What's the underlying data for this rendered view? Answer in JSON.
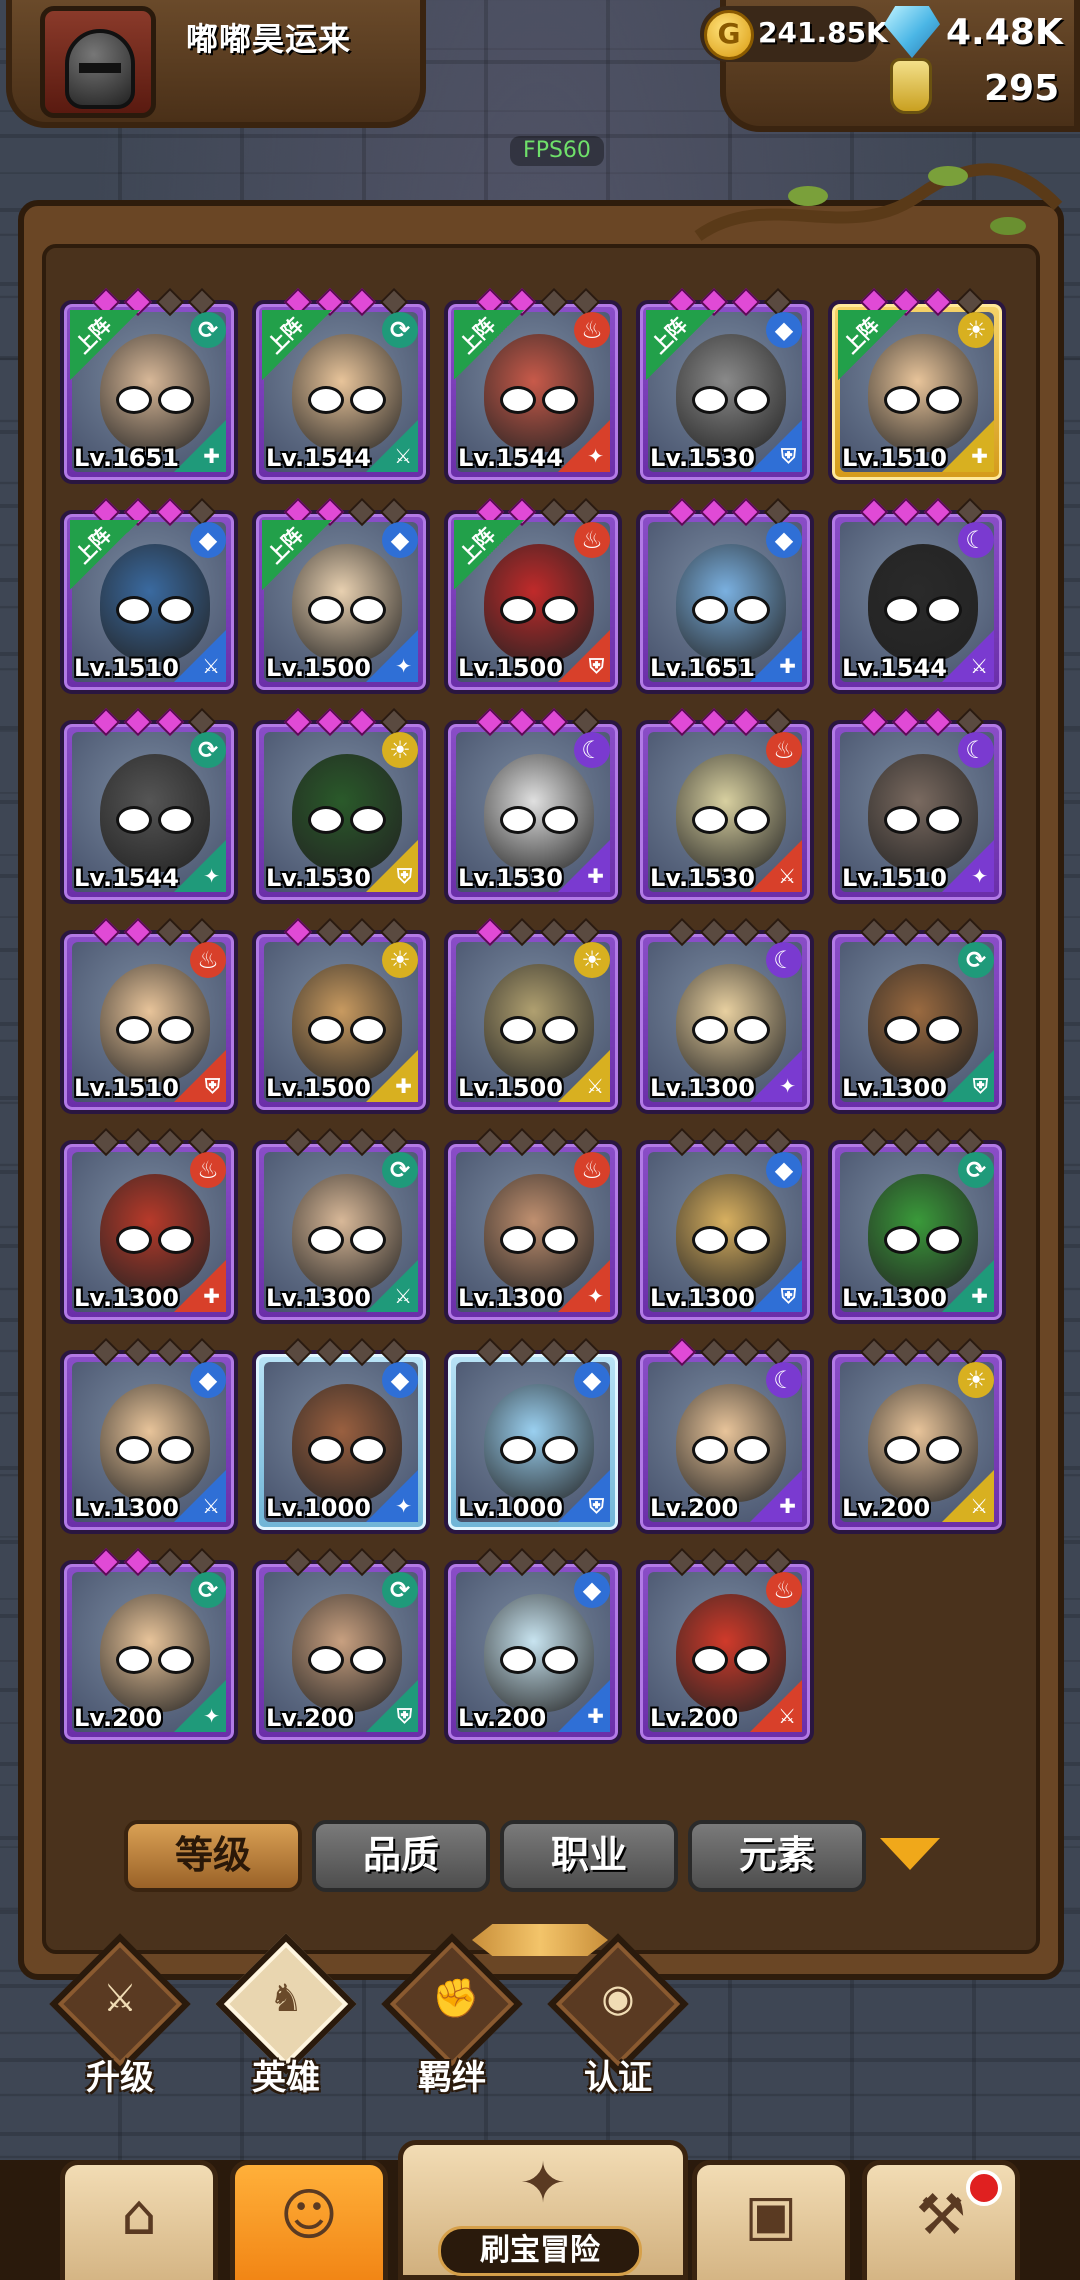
{
  "player": {
    "name": "嘟嘟昊运来"
  },
  "resources": {
    "gold": "241.85K",
    "gems": "4.48K",
    "potions": "295"
  },
  "fps": "FPS60",
  "deploy_label": "上阵",
  "heroes": [
    {
      "lv": "Lv.1651",
      "deployed": true,
      "rarity": "purple",
      "element": "wind",
      "stars": [
        1,
        1,
        0,
        0
      ],
      "skin": "#d8b898"
    },
    {
      "lv": "Lv.1544",
      "deployed": true,
      "rarity": "purple",
      "element": "wind",
      "stars": [
        1,
        1,
        1,
        0
      ],
      "skin": "#e8c49a"
    },
    {
      "lv": "Lv.1544",
      "deployed": true,
      "rarity": "purple",
      "element": "fire",
      "stars": [
        1,
        1,
        0,
        0
      ],
      "skin": "#c85a4a"
    },
    {
      "lv": "Lv.1530",
      "deployed": true,
      "rarity": "purple",
      "element": "water",
      "stars": [
        1,
        1,
        1,
        0
      ],
      "skin": "#8a8a8a"
    },
    {
      "lv": "Lv.1510",
      "deployed": true,
      "rarity": "gold",
      "element": "light",
      "stars": [
        1,
        1,
        1,
        0
      ],
      "skin": "#e8c49a"
    },
    {
      "lv": "Lv.1510",
      "deployed": true,
      "rarity": "purple",
      "element": "water",
      "stars": [
        1,
        1,
        1,
        0
      ],
      "skin": "#3a6aa0"
    },
    {
      "lv": "Lv.1500",
      "deployed": true,
      "rarity": "purple",
      "element": "water",
      "stars": [
        1,
        1,
        0,
        0
      ],
      "skin": "#e8d0b0"
    },
    {
      "lv": "Lv.1500",
      "deployed": true,
      "rarity": "purple",
      "element": "fire",
      "stars": [
        1,
        1,
        0,
        0
      ],
      "skin": "#c02a2a"
    },
    {
      "lv": "Lv.1651",
      "deployed": false,
      "rarity": "purple",
      "element": "water",
      "stars": [
        1,
        1,
        1,
        0
      ],
      "skin": "#7ab0e0"
    },
    {
      "lv": "Lv.1544",
      "deployed": false,
      "rarity": "purple",
      "element": "dark",
      "stars": [
        1,
        1,
        1,
        0
      ],
      "skin": "#2a2a2a"
    },
    {
      "lv": "Lv.1544",
      "deployed": false,
      "rarity": "purple",
      "element": "wind",
      "stars": [
        1,
        1,
        1,
        0
      ],
      "skin": "#555555"
    },
    {
      "lv": "Lv.1530",
      "deployed": false,
      "rarity": "purple",
      "element": "light",
      "stars": [
        1,
        1,
        1,
        0
      ],
      "skin": "#2a5a2a"
    },
    {
      "lv": "Lv.1530",
      "deployed": false,
      "rarity": "purple",
      "element": "dark",
      "stars": [
        1,
        1,
        1,
        0
      ],
      "skin": "#e0e0e0"
    },
    {
      "lv": "Lv.1530",
      "deployed": false,
      "rarity": "purple",
      "element": "fire",
      "stars": [
        1,
        1,
        1,
        0
      ],
      "skin": "#d8d0a0"
    },
    {
      "lv": "Lv.1510",
      "deployed": false,
      "rarity": "purple",
      "element": "dark",
      "stars": [
        1,
        1,
        1,
        0
      ],
      "skin": "#7a6a60"
    },
    {
      "lv": "Lv.1510",
      "deployed": false,
      "rarity": "purple",
      "element": "fire",
      "stars": [
        1,
        1,
        0,
        0
      ],
      "skin": "#e8c49a"
    },
    {
      "lv": "Lv.1500",
      "deployed": false,
      "rarity": "purple",
      "element": "light",
      "stars": [
        1,
        0,
        0,
        0
      ],
      "skin": "#c89a60"
    },
    {
      "lv": "Lv.1500",
      "deployed": false,
      "rarity": "purple",
      "element": "light",
      "stars": [
        1,
        0,
        0,
        0
      ],
      "skin": "#b0a070"
    },
    {
      "lv": "Lv.1300",
      "deployed": false,
      "rarity": "purple",
      "element": "dark",
      "stars": [
        0,
        0,
        0,
        0
      ],
      "skin": "#e8d0a0"
    },
    {
      "lv": "Lv.1300",
      "deployed": false,
      "rarity": "purple",
      "element": "wind",
      "stars": [
        0,
        0,
        0,
        0
      ],
      "skin": "#9a6a40"
    },
    {
      "lv": "Lv.1300",
      "deployed": false,
      "rarity": "purple",
      "element": "fire",
      "stars": [
        0,
        0,
        0,
        0
      ],
      "skin": "#b83a2a"
    },
    {
      "lv": "Lv.1300",
      "deployed": false,
      "rarity": "purple",
      "element": "wind",
      "stars": [
        0,
        0,
        0,
        0
      ],
      "skin": "#d8b898"
    },
    {
      "lv": "Lv.1300",
      "deployed": false,
      "rarity": "purple",
      "element": "fire",
      "stars": [
        0,
        0,
        0,
        0
      ],
      "skin": "#c09070"
    },
    {
      "lv": "Lv.1300",
      "deployed": false,
      "rarity": "purple",
      "element": "water",
      "stars": [
        0,
        0,
        0,
        0
      ],
      "skin": "#d8b060"
    },
    {
      "lv": "Lv.1300",
      "deployed": false,
      "rarity": "purple",
      "element": "wind",
      "stars": [
        0,
        0,
        0,
        0
      ],
      "skin": "#3a9a3a"
    },
    {
      "lv": "Lv.1300",
      "deployed": false,
      "rarity": "purple",
      "element": "water",
      "stars": [
        0,
        0,
        0,
        0
      ],
      "skin": "#e8c49a"
    },
    {
      "lv": "Lv.1000",
      "deployed": false,
      "rarity": "blue",
      "element": "water",
      "stars": [
        0,
        0,
        0,
        0
      ],
      "skin": "#9a6040"
    },
    {
      "lv": "Lv.1000",
      "deployed": false,
      "rarity": "blue",
      "element": "water",
      "stars": [
        0,
        0,
        0,
        0
      ],
      "skin": "#9ad0f0"
    },
    {
      "lv": "Lv.200",
      "deployed": false,
      "rarity": "purple",
      "element": "dark",
      "stars": [
        1,
        0,
        0,
        0
      ],
      "skin": "#e8c49a"
    },
    {
      "lv": "Lv.200",
      "deployed": false,
      "rarity": "purple",
      "element": "light",
      "stars": [
        0,
        0,
        0,
        0
      ],
      "skin": "#e8c49a"
    },
    {
      "lv": "Lv.200",
      "deployed": false,
      "rarity": "purple",
      "element": "wind",
      "stars": [
        1,
        1,
        0,
        0
      ],
      "skin": "#e8c49a"
    },
    {
      "lv": "Lv.200",
      "deployed": false,
      "rarity": "purple",
      "element": "wind",
      "stars": [
        0,
        0,
        0,
        0
      ],
      "skin": "#c8a080"
    },
    {
      "lv": "Lv.200",
      "deployed": false,
      "rarity": "purple",
      "element": "water",
      "stars": [
        0,
        0,
        0,
        0
      ],
      "skin": "#c8e4f0"
    },
    {
      "lv": "Lv.200",
      "deployed": false,
      "rarity": "purple",
      "element": "fire",
      "stars": [
        0,
        0,
        0,
        0
      ],
      "skin": "#d03a2a"
    }
  ],
  "sort_tabs": [
    {
      "label": "等级",
      "active": true
    },
    {
      "label": "品质",
      "active": false
    },
    {
      "label": "职业",
      "active": false
    },
    {
      "label": "元素",
      "active": false
    }
  ],
  "sub_tabs": [
    {
      "label": "升级",
      "icon": "sword-icon",
      "active": false
    },
    {
      "label": "英雄",
      "icon": "hero-icon",
      "active": true
    },
    {
      "label": "羁绊",
      "icon": "fist-icon",
      "active": false
    },
    {
      "label": "认证",
      "icon": "eye-icon",
      "active": false
    }
  ],
  "bottom_nav": {
    "center_label": "刷宝冒险"
  },
  "colors": {
    "accent": "#f08010",
    "panel": "#6a4625",
    "purple": "#7a3ac0"
  }
}
